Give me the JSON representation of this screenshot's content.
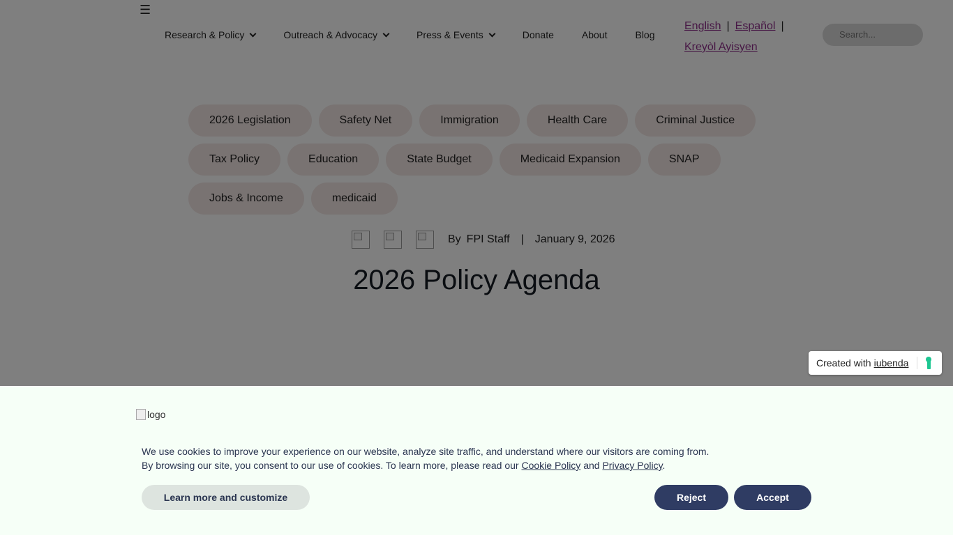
{
  "header": {
    "menu_icon": "hamburger-menu-icon",
    "nav": [
      {
        "label": "Research & Policy",
        "dropdown": true
      },
      {
        "label": "Outreach & Advocacy",
        "dropdown": true
      },
      {
        "label": "Press & Events",
        "dropdown": true
      },
      {
        "label": "Donate",
        "dropdown": false
      },
      {
        "label": "About",
        "dropdown": false
      },
      {
        "label": "Blog",
        "dropdown": false
      }
    ],
    "languages": [
      "English",
      "Español",
      "Kreyòl Ayisyen"
    ],
    "search_placeholder": "Search..."
  },
  "tags": [
    [
      "2026 Legislation",
      "Safety Net",
      "Immigration",
      "Health Care",
      "Criminal Justice"
    ],
    [
      "Tax Policy",
      "Education",
      "State Budget",
      "Medicaid Expansion",
      "SNAP"
    ],
    [
      "Jobs & Income",
      "medicaid"
    ]
  ],
  "article": {
    "by_label": "By",
    "author": "FPI Staff",
    "separator": "|",
    "date": "January 9, 2026",
    "title": "2026 Policy Agenda"
  },
  "iubenda": {
    "prefix": "Created with",
    "link": "iubenda"
  },
  "cookie_banner": {
    "logo_alt": "logo",
    "line1": "We use cookies to improve your experience on our website, analyze site traffic, and understand where our visitors are coming from.",
    "line2_prefix": "By browsing our site, you consent to our use of cookies. To learn more, please read our",
    "cookie_policy": "Cookie Policy",
    "and": "and",
    "privacy_policy": "Privacy Policy",
    "period": ".",
    "learn_more": "Learn more and customize",
    "reject": "Reject",
    "accept": "Accept"
  },
  "colors": {
    "accent_link": "#8e2f8a",
    "button_dark": "#2f3c63",
    "banner_bg": "#f6fff7",
    "iubenda_green": "#1cc691"
  }
}
